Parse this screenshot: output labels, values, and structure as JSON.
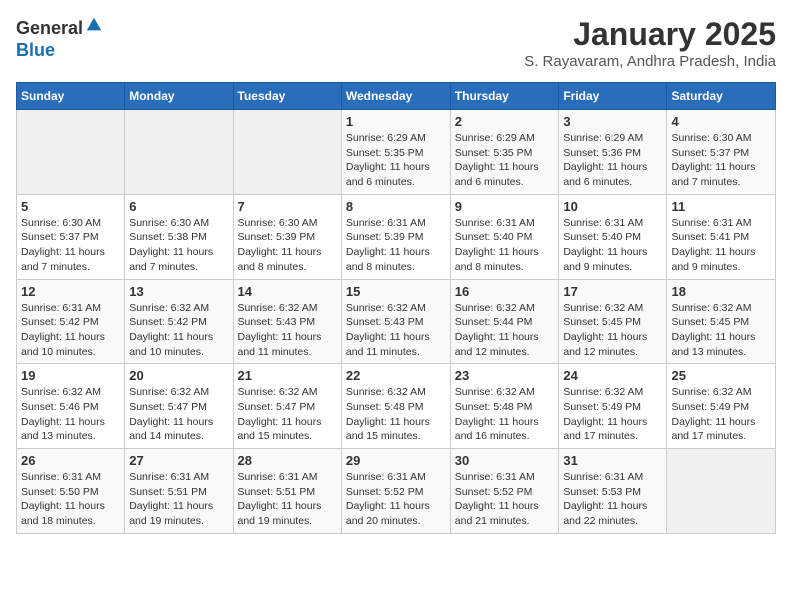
{
  "header": {
    "logo_line1": "General",
    "logo_line2": "Blue",
    "title": "January 2025",
    "subtitle": "S. Rayavaram, Andhra Pradesh, India"
  },
  "calendar": {
    "days_of_week": [
      "Sunday",
      "Monday",
      "Tuesday",
      "Wednesday",
      "Thursday",
      "Friday",
      "Saturday"
    ],
    "weeks": [
      [
        {
          "day": "",
          "info": ""
        },
        {
          "day": "",
          "info": ""
        },
        {
          "day": "",
          "info": ""
        },
        {
          "day": "1",
          "info": "Sunrise: 6:29 AM\nSunset: 5:35 PM\nDaylight: 11 hours and 6 minutes."
        },
        {
          "day": "2",
          "info": "Sunrise: 6:29 AM\nSunset: 5:35 PM\nDaylight: 11 hours and 6 minutes."
        },
        {
          "day": "3",
          "info": "Sunrise: 6:29 AM\nSunset: 5:36 PM\nDaylight: 11 hours and 6 minutes."
        },
        {
          "day": "4",
          "info": "Sunrise: 6:30 AM\nSunset: 5:37 PM\nDaylight: 11 hours and 7 minutes."
        }
      ],
      [
        {
          "day": "5",
          "info": "Sunrise: 6:30 AM\nSunset: 5:37 PM\nDaylight: 11 hours and 7 minutes."
        },
        {
          "day": "6",
          "info": "Sunrise: 6:30 AM\nSunset: 5:38 PM\nDaylight: 11 hours and 7 minutes."
        },
        {
          "day": "7",
          "info": "Sunrise: 6:30 AM\nSunset: 5:39 PM\nDaylight: 11 hours and 8 minutes."
        },
        {
          "day": "8",
          "info": "Sunrise: 6:31 AM\nSunset: 5:39 PM\nDaylight: 11 hours and 8 minutes."
        },
        {
          "day": "9",
          "info": "Sunrise: 6:31 AM\nSunset: 5:40 PM\nDaylight: 11 hours and 8 minutes."
        },
        {
          "day": "10",
          "info": "Sunrise: 6:31 AM\nSunset: 5:40 PM\nDaylight: 11 hours and 9 minutes."
        },
        {
          "day": "11",
          "info": "Sunrise: 6:31 AM\nSunset: 5:41 PM\nDaylight: 11 hours and 9 minutes."
        }
      ],
      [
        {
          "day": "12",
          "info": "Sunrise: 6:31 AM\nSunset: 5:42 PM\nDaylight: 11 hours and 10 minutes."
        },
        {
          "day": "13",
          "info": "Sunrise: 6:32 AM\nSunset: 5:42 PM\nDaylight: 11 hours and 10 minutes."
        },
        {
          "day": "14",
          "info": "Sunrise: 6:32 AM\nSunset: 5:43 PM\nDaylight: 11 hours and 11 minutes."
        },
        {
          "day": "15",
          "info": "Sunrise: 6:32 AM\nSunset: 5:43 PM\nDaylight: 11 hours and 11 minutes."
        },
        {
          "day": "16",
          "info": "Sunrise: 6:32 AM\nSunset: 5:44 PM\nDaylight: 11 hours and 12 minutes."
        },
        {
          "day": "17",
          "info": "Sunrise: 6:32 AM\nSunset: 5:45 PM\nDaylight: 11 hours and 12 minutes."
        },
        {
          "day": "18",
          "info": "Sunrise: 6:32 AM\nSunset: 5:45 PM\nDaylight: 11 hours and 13 minutes."
        }
      ],
      [
        {
          "day": "19",
          "info": "Sunrise: 6:32 AM\nSunset: 5:46 PM\nDaylight: 11 hours and 13 minutes."
        },
        {
          "day": "20",
          "info": "Sunrise: 6:32 AM\nSunset: 5:47 PM\nDaylight: 11 hours and 14 minutes."
        },
        {
          "day": "21",
          "info": "Sunrise: 6:32 AM\nSunset: 5:47 PM\nDaylight: 11 hours and 15 minutes."
        },
        {
          "day": "22",
          "info": "Sunrise: 6:32 AM\nSunset: 5:48 PM\nDaylight: 11 hours and 15 minutes."
        },
        {
          "day": "23",
          "info": "Sunrise: 6:32 AM\nSunset: 5:48 PM\nDaylight: 11 hours and 16 minutes."
        },
        {
          "day": "24",
          "info": "Sunrise: 6:32 AM\nSunset: 5:49 PM\nDaylight: 11 hours and 17 minutes."
        },
        {
          "day": "25",
          "info": "Sunrise: 6:32 AM\nSunset: 5:49 PM\nDaylight: 11 hours and 17 minutes."
        }
      ],
      [
        {
          "day": "26",
          "info": "Sunrise: 6:31 AM\nSunset: 5:50 PM\nDaylight: 11 hours and 18 minutes."
        },
        {
          "day": "27",
          "info": "Sunrise: 6:31 AM\nSunset: 5:51 PM\nDaylight: 11 hours and 19 minutes."
        },
        {
          "day": "28",
          "info": "Sunrise: 6:31 AM\nSunset: 5:51 PM\nDaylight: 11 hours and 19 minutes."
        },
        {
          "day": "29",
          "info": "Sunrise: 6:31 AM\nSunset: 5:52 PM\nDaylight: 11 hours and 20 minutes."
        },
        {
          "day": "30",
          "info": "Sunrise: 6:31 AM\nSunset: 5:52 PM\nDaylight: 11 hours and 21 minutes."
        },
        {
          "day": "31",
          "info": "Sunrise: 6:31 AM\nSunset: 5:53 PM\nDaylight: 11 hours and 22 minutes."
        },
        {
          "day": "",
          "info": ""
        }
      ]
    ]
  }
}
